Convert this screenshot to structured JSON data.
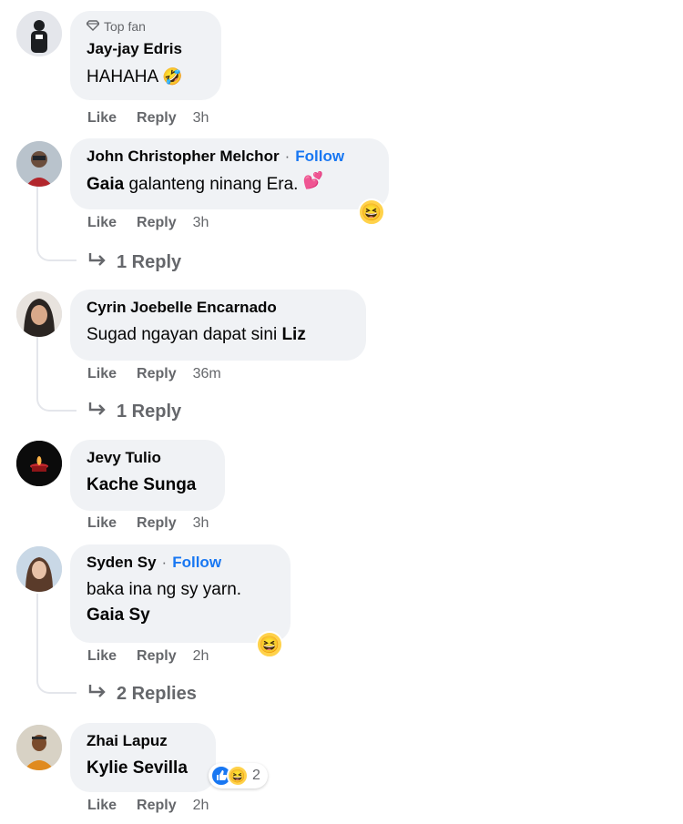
{
  "colors": {
    "bubble": "#f0f2f5",
    "follow": "#1877f2",
    "meta": "#65676b"
  },
  "comments": [
    {
      "badge": "Top fan",
      "name": "Jay-jay Edris",
      "text": "HAHAHA",
      "text_emoji": "🤣",
      "actions": {
        "like": "Like",
        "reply": "Reply",
        "time": "3h"
      }
    },
    {
      "name": "John Christopher Melchor",
      "follow": "Follow",
      "sep": "·",
      "text_bold": "Gaia",
      "text": "galanteng ninang Era.",
      "text_emoji": "💕",
      "reaction": "😆",
      "actions": {
        "like": "Like",
        "reply": "Reply",
        "time": "3h"
      },
      "replies": "1 Reply"
    },
    {
      "name": "Cyrin Joebelle Encarnado",
      "text": "Sugad ngayan dapat sini",
      "text_bold": "Liz",
      "actions": {
        "like": "Like",
        "reply": "Reply",
        "time": "36m"
      },
      "replies": "1 Reply"
    },
    {
      "name": "Jevy Tulio",
      "text_bold": "Kache Sunga",
      "actions": {
        "like": "Like",
        "reply": "Reply",
        "time": "3h"
      }
    },
    {
      "name": "Syden Sy",
      "follow": "Follow",
      "sep": "·",
      "text": "baka ina ng sy yarn.",
      "text_bold": "Gaia Sy",
      "reaction": "😆",
      "actions": {
        "like": "Like",
        "reply": "Reply",
        "time": "2h"
      },
      "replies": "2 Replies"
    },
    {
      "name": "Zhai Lapuz",
      "text_bold": "Kylie Sevilla",
      "reactions": {
        "icons": [
          "like-icon",
          "haha-icon"
        ],
        "count": "2"
      },
      "actions": {
        "like": "Like",
        "reply": "Reply",
        "time": "2h"
      }
    }
  ]
}
